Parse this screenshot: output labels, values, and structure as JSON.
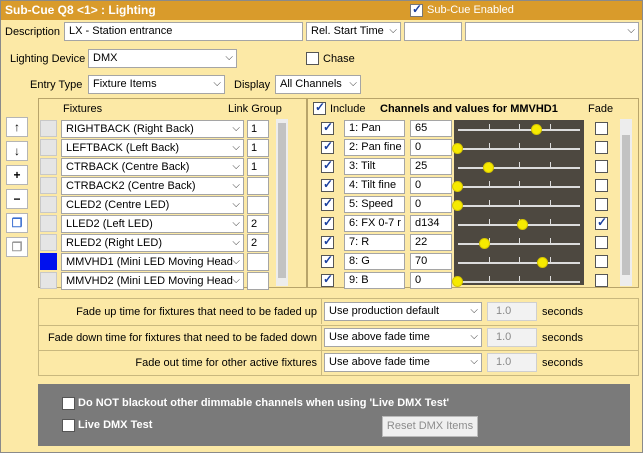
{
  "title": "Sub-Cue Q8 <1> : Lighting",
  "sub_cue_enabled": {
    "label": "Sub-Cue Enabled",
    "checked": true
  },
  "description": {
    "label": "Description",
    "value": "LX - Station entrance"
  },
  "start_time": {
    "select": "Rel. Start Time",
    "value": "",
    "extra": ""
  },
  "lighting_device": {
    "label": "Lighting Device",
    "value": "DMX"
  },
  "chase": {
    "label": "Chase",
    "checked": false
  },
  "entry_type": {
    "label": "Entry Type",
    "value": "Fixture Items"
  },
  "display": {
    "label": "Display",
    "value": "All Channels"
  },
  "fixtures_header": "Fixtures",
  "link_group_header": "Link Group",
  "include": {
    "label": "Include",
    "checked": true
  },
  "channels_header": "Channels and values for MMVHD1",
  "fade_header": "Fade",
  "side_buttons": [
    {
      "name": "move-up",
      "icon": "arrow-up-icon",
      "glyph": "🠕"
    },
    {
      "name": "move-down",
      "icon": "arrow-down-icon",
      "glyph": "🠗"
    },
    {
      "name": "add",
      "icon": "plus-icon",
      "glyph": "+"
    },
    {
      "name": "remove",
      "icon": "minus-icon",
      "glyph": "−"
    },
    {
      "name": "copy",
      "icon": "copy-icon",
      "glyph": "⧉"
    },
    {
      "name": "paste",
      "icon": "paste-icon",
      "glyph": "⧉"
    }
  ],
  "fixtures": [
    {
      "label": "RIGHTBACK (Right Back)",
      "link": "1",
      "color": ""
    },
    {
      "label": "LEFTBACK (Left Back)",
      "link": "1",
      "color": ""
    },
    {
      "label": "CTRBACK (Centre Back)",
      "link": "1",
      "color": ""
    },
    {
      "label": "CTRBACK2 (Centre Back)",
      "link": "",
      "color": ""
    },
    {
      "label": "CLED2 (Centre LED)",
      "link": "",
      "color": ""
    },
    {
      "label": "LLED2 (Left LED)",
      "link": "2",
      "color": ""
    },
    {
      "label": "RLED2 (Right LED)",
      "link": "2",
      "color": ""
    },
    {
      "label": "MMVHD1 (Mini LED Moving Head",
      "link": "",
      "color": "#0010ee"
    },
    {
      "label": "MMVHD2 (Mini LED Moving Head",
      "link": "",
      "color": ""
    }
  ],
  "channels": [
    {
      "label": "1: Pan",
      "value": "65",
      "include": true,
      "fade": false,
      "level": 0.65
    },
    {
      "label": "2: Pan fine",
      "value": "0",
      "include": true,
      "fade": false,
      "level": 0.0
    },
    {
      "label": "3: Tilt",
      "value": "25",
      "include": true,
      "fade": false,
      "level": 0.25
    },
    {
      "label": "4: Tilt fine",
      "value": "0",
      "include": true,
      "fade": false,
      "level": 0.0
    },
    {
      "label": "5: Speed",
      "value": "0",
      "include": true,
      "fade": false,
      "level": 0.0
    },
    {
      "label": "6: FX 0-7 r",
      "value": "d134",
      "include": true,
      "fade": true,
      "level": 0.53
    },
    {
      "label": "7: R",
      "value": "22",
      "include": true,
      "fade": false,
      "level": 0.22
    },
    {
      "label": "8: G",
      "value": "70",
      "include": true,
      "fade": false,
      "level": 0.7
    },
    {
      "label": "9: B",
      "value": "0",
      "include": true,
      "fade": false,
      "level": 0.0
    }
  ],
  "fade_rows": [
    {
      "label": "Fade up time for fixtures that need to be faded up",
      "select": "Use production default",
      "value": "1.0",
      "unit": "seconds"
    },
    {
      "label": "Fade down time for fixtures that need to be faded down",
      "select": "Use above fade time",
      "value": "1.0",
      "unit": "seconds"
    },
    {
      "label": "Fade out time for other active fixtures",
      "select": "Use above fade time",
      "value": "1.0",
      "unit": "seconds"
    }
  ],
  "no_blackout": {
    "label": "Do NOT blackout other dimmable channels when using 'Live DMX Test'",
    "checked": false
  },
  "live_dmx_test": {
    "label": "Live DMX Test",
    "checked": false
  },
  "reset_dmx": "Reset DMX Items"
}
